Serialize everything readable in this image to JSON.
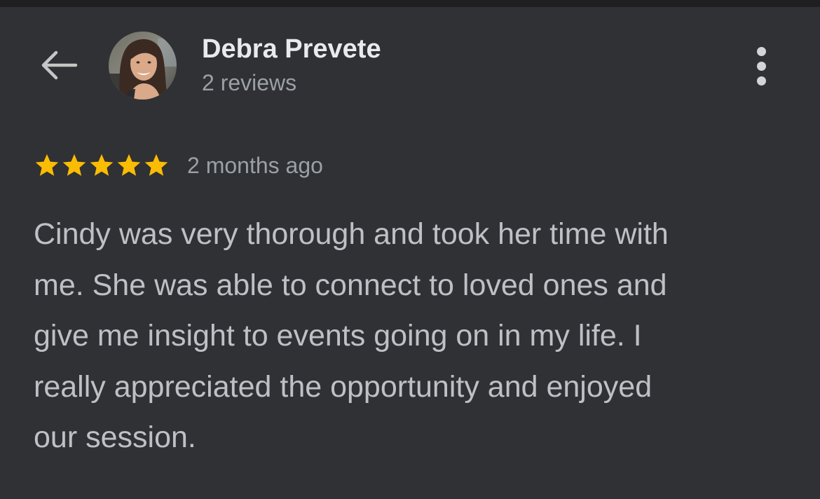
{
  "header": {
    "back_icon": "arrow-left-icon",
    "more_icon": "more-vertical-icon"
  },
  "reviewer": {
    "name": "Debra Prevete",
    "review_count": "2 reviews",
    "avatar": "reviewer-avatar-photo"
  },
  "review": {
    "rating": 5,
    "rating_max": 5,
    "date": "2 months ago",
    "text_lines": [
      "Cindy was very thorough and took her time with",
      "me. She was able to connect to loved ones and",
      "give me insight to events going on in my life. I",
      "really appreciated the opportunity and enjoyed",
      "our session."
    ]
  },
  "colors": {
    "background": "#303134",
    "star": "#fbbc04",
    "primary_text": "#e8eaed",
    "secondary_text": "#9aa0a6",
    "body_text": "#bdc1c6"
  }
}
